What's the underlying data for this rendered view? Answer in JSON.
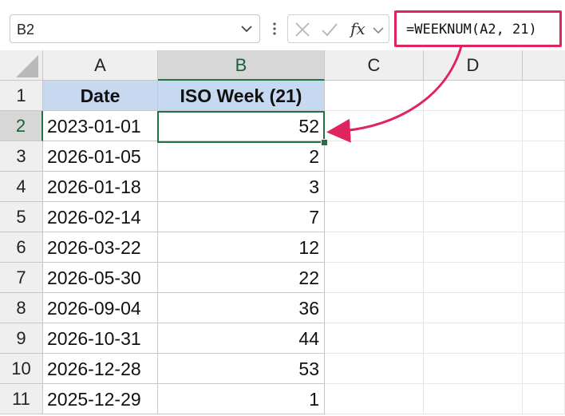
{
  "formula_bar": {
    "name_box": "B2",
    "formula": "=WEEKNUM(A2, 21)",
    "fx_label": "fx"
  },
  "columns": [
    "A",
    "B",
    "C",
    "D"
  ],
  "rows": [
    "1",
    "2",
    "3",
    "4",
    "5",
    "6",
    "7",
    "8",
    "9",
    "10",
    "11"
  ],
  "sheet": {
    "header_a": "Date",
    "header_b": "ISO Week (21)",
    "data": [
      {
        "date": "2023-01-01",
        "week": "52"
      },
      {
        "date": "2026-01-05",
        "week": "2"
      },
      {
        "date": "2026-01-18",
        "week": "3"
      },
      {
        "date": "2026-02-14",
        "week": "7"
      },
      {
        "date": "2026-03-22",
        "week": "12"
      },
      {
        "date": "2026-05-30",
        "week": "22"
      },
      {
        "date": "2026-09-04",
        "week": "36"
      },
      {
        "date": "2026-10-31",
        "week": "44"
      },
      {
        "date": "2026-12-28",
        "week": "53"
      },
      {
        "date": "2025-12-29",
        "week": "1"
      }
    ]
  },
  "colors": {
    "accent": "#217346",
    "header_fill": "#c6d9f1",
    "highlight": "#e0245e"
  },
  "icons": [
    "chevron-down-icon",
    "more-icon",
    "cancel-icon",
    "enter-icon",
    "function-icon"
  ]
}
